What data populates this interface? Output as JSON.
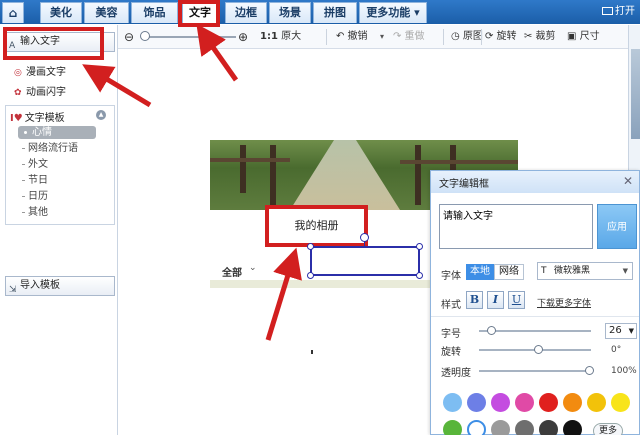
{
  "tabs": {
    "home_icon": "⌂",
    "beautify": "美化",
    "beauty": "美容",
    "accessories": "饰品",
    "text": "文字",
    "border": "边框",
    "scene": "场景",
    "puzzle": "拼图",
    "more": "更多功能 ▾",
    "open": "打开"
  },
  "toolbar": {
    "zoom_out_icon": "⊖",
    "zoom_in_icon": "⊕",
    "actual_size_prefix": "1:1",
    "actual_size": "原大",
    "undo": "↶ 撤销",
    "undo_dropdown": "▾",
    "redo": "↷ 重做",
    "original": "◷ 原图",
    "rotate": "⟳ 旋转",
    "crop": "✂ 裁剪",
    "size": "▣ 尺寸"
  },
  "left_panel": {
    "input_text": "输入文字",
    "comic_text": "漫画文字",
    "anim_text": "动画闪字",
    "template_title": "文字模板",
    "template_icon": "I♥",
    "categories": [
      "心情",
      "网络流行语",
      "外文",
      "节日",
      "日历",
      "其他"
    ],
    "import_template": "导入模板"
  },
  "canvas": {
    "album_label": "我的相册",
    "all_label": "全部",
    "all_dropdown": "⌄"
  },
  "dialog": {
    "title": "文字编辑框",
    "close": "✕",
    "placeholder_text": "请输入文字",
    "apply": "应用",
    "font_label": "字体",
    "seg_local": "本地",
    "seg_web": "网络",
    "font_name": "微软雅黑",
    "style_label": "样式",
    "bold": "B",
    "italic": "I",
    "underline": "U",
    "more_fonts": "下载更多字体",
    "size_label": "字号",
    "size_value": "26",
    "rotate_label": "旋转",
    "rotate_value": "0°",
    "opacity_label": "透明度",
    "opacity_value": "100%",
    "more_colors": "更多",
    "swatches_row1": [
      "#7dbdf2",
      "#6d7fe6",
      "#c44ce0",
      "#e04aa6",
      "#e0201e",
      "#f28b10",
      "#f2c20a",
      "#f8e41a"
    ],
    "swatches_row2": [
      "#58b53a",
      "#ffffff",
      "#9a9a9a",
      "#6e6e6e",
      "#3c3c3c",
      "#111111"
    ]
  },
  "colors": {
    "highlight": "#d21f1f",
    "selection": "#2b2fa9",
    "tab_bar": "#1b5ea8",
    "apply": "#5aa8e8"
  }
}
